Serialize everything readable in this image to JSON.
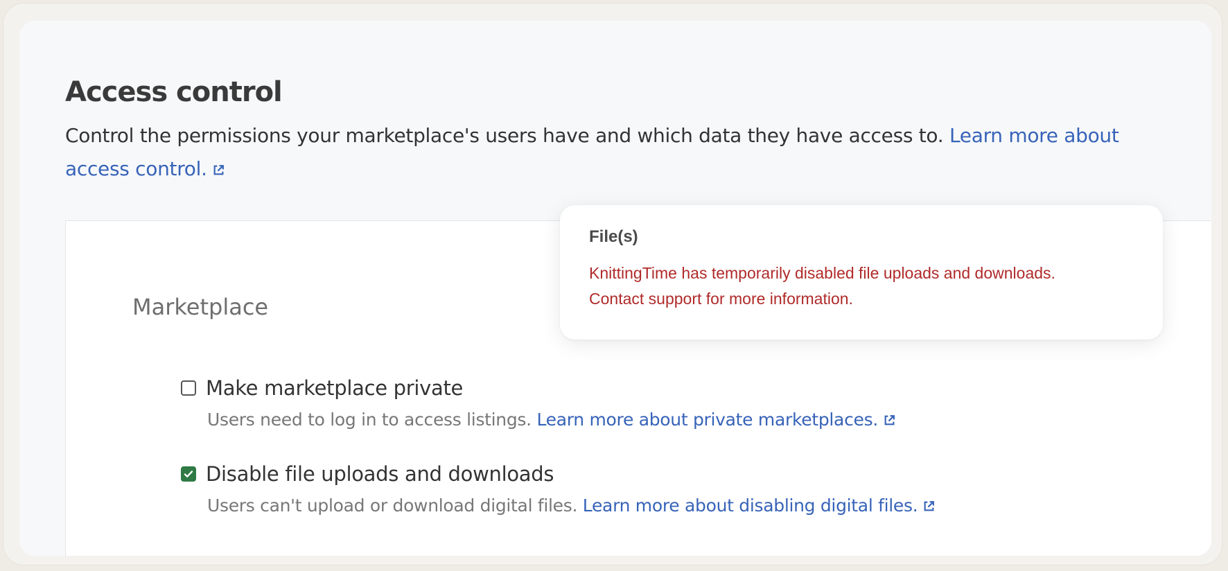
{
  "page": {
    "title": "Access control",
    "intro_text": "Control the permissions your marketplace's users have and which data they have access to.",
    "intro_link": "Learn more about access control."
  },
  "marketplace": {
    "section_title": "Marketplace",
    "options": [
      {
        "label": "Make marketplace private",
        "checked": false,
        "description": "Users need to log in to access listings.",
        "link": "Learn more about private marketplaces."
      },
      {
        "label": "Disable file uploads and downloads",
        "checked": true,
        "description": "Users can't upload or download digital files.",
        "link": "Learn more about disabling digital files."
      }
    ]
  },
  "tooltip": {
    "title": "File(s)",
    "line1": "KnittingTime has temporarily disabled file uploads and downloads.",
    "line2": "Contact support for more information."
  },
  "colors": {
    "link": "#3763b8",
    "checkbox_checked": "#2f7a45",
    "error_text": "#b02a2a",
    "panel_background": "#f7f8fa"
  },
  "icons": {
    "external_link": "external-link-icon",
    "checkmark": "checkmark-icon"
  }
}
